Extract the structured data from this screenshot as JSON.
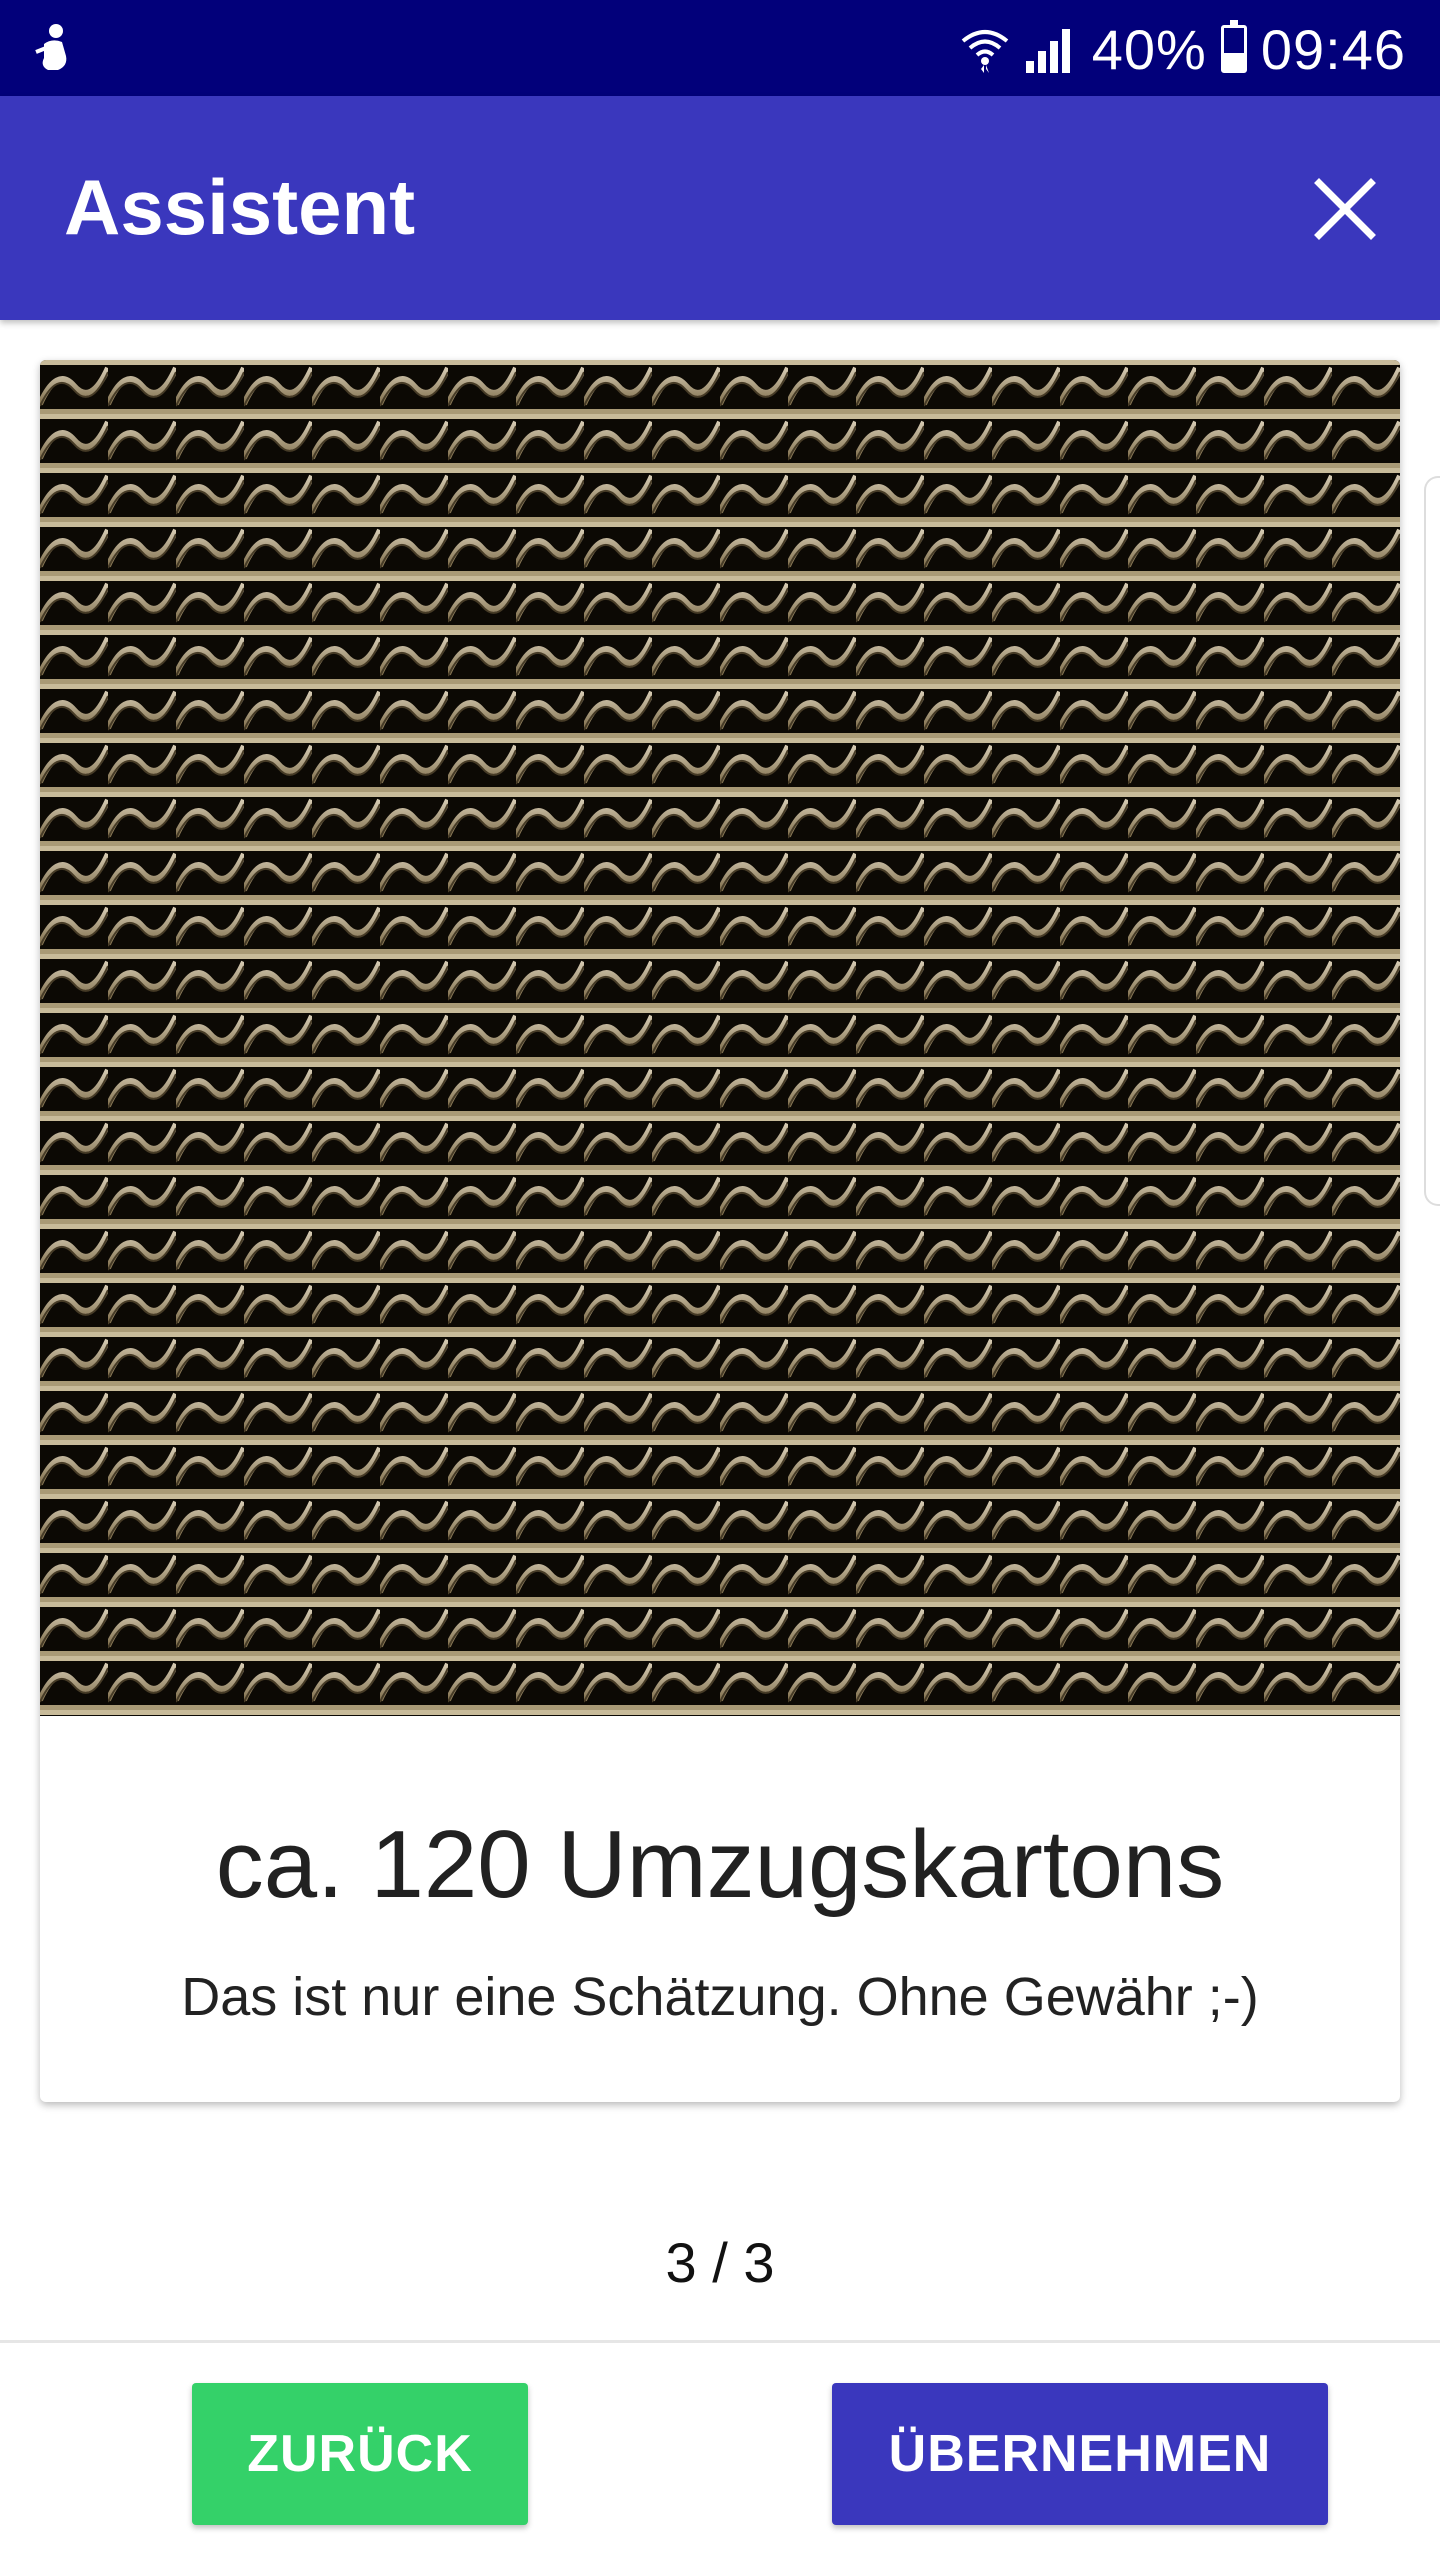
{
  "status_bar": {
    "battery": "40%",
    "battery_level": 0.4,
    "time": "09:46"
  },
  "app_bar": {
    "title": "Assistent",
    "close_icon": "close-icon"
  },
  "card": {
    "image_icon": "corrugated-cardboard-image",
    "title": "ca. 120 Umzugskartons",
    "subtitle": "Das ist nur eine Schätzung. Ohne Gewähr ;-)"
  },
  "pager": "3 / 3",
  "buttons": {
    "back": "ZURÜCK",
    "apply": "ÜBERNEHMEN"
  },
  "colors": {
    "status_bar": "#02007a",
    "app_bar": "#3a37bd",
    "back_button": "#34d169",
    "apply_button": "#3a37bd"
  }
}
